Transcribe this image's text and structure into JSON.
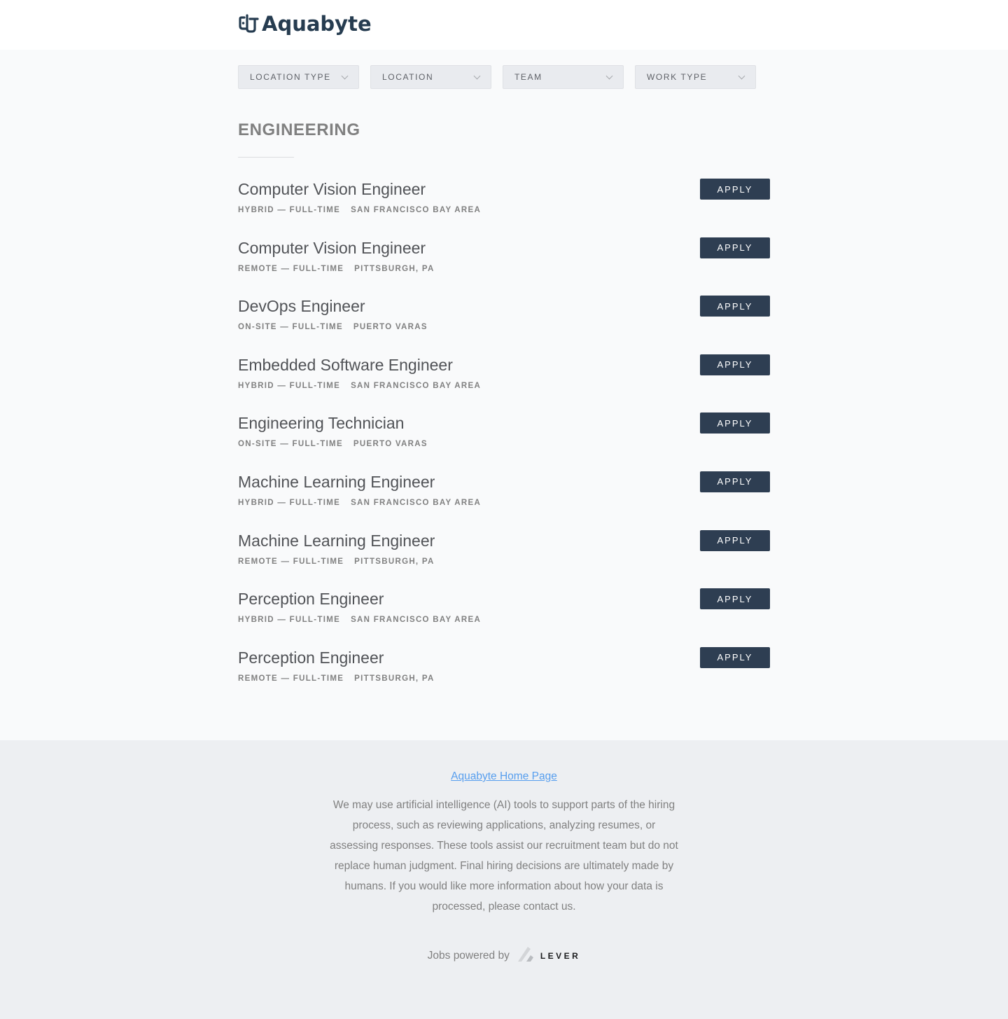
{
  "header": {
    "logo_text": "Aquabyte",
    "logo_icon": "aquabyte-logo-icon"
  },
  "filters": [
    {
      "label": "LOCATION TYPE"
    },
    {
      "label": "LOCATION"
    },
    {
      "label": "TEAM"
    },
    {
      "label": "WORK TYPE"
    }
  ],
  "section": {
    "title": "ENGINEERING"
  },
  "apply_label": "APPLY",
  "postings": [
    {
      "title": "Computer Vision Engineer",
      "commitment": "HYBRID — FULL-TIME",
      "location": "SAN FRANCISCO BAY AREA"
    },
    {
      "title": "Computer Vision Engineer",
      "commitment": "REMOTE — FULL-TIME",
      "location": "PITTSBURGH, PA"
    },
    {
      "title": "DevOps Engineer",
      "commitment": "ON-SITE — FULL-TIME",
      "location": "PUERTO VARAS"
    },
    {
      "title": "Embedded Software Engineer",
      "commitment": "HYBRID — FULL-TIME",
      "location": "SAN FRANCISCO BAY AREA"
    },
    {
      "title": "Engineering Technician",
      "commitment": "ON-SITE — FULL-TIME",
      "location": "PUERTO VARAS"
    },
    {
      "title": "Machine Learning Engineer",
      "commitment": "HYBRID — FULL-TIME",
      "location": "SAN FRANCISCO BAY AREA"
    },
    {
      "title": "Machine Learning Engineer",
      "commitment": "REMOTE — FULL-TIME",
      "location": "PITTSBURGH, PA"
    },
    {
      "title": "Perception Engineer",
      "commitment": "HYBRID — FULL-TIME",
      "location": "SAN FRANCISCO BAY AREA"
    },
    {
      "title": "Perception Engineer",
      "commitment": "REMOTE — FULL-TIME",
      "location": "PITTSBURGH, PA"
    }
  ],
  "footer": {
    "home_link": "Aquabyte Home Page",
    "disclaimer": "We may use artificial intelligence (AI) tools to support parts of the hiring process, such as reviewing applications, analyzing resumes, or assessing responses. These tools assist our recruitment team but do not replace human judgment. Final hiring decisions are ultimately made by humans. If you would like more information about how your data is processed, please contact us.",
    "powered_by": "Jobs powered by",
    "lever_word": "LEVER"
  },
  "colors": {
    "brand": "#263c50",
    "apply_bg": "#2e3e52",
    "link": "#579eee"
  }
}
